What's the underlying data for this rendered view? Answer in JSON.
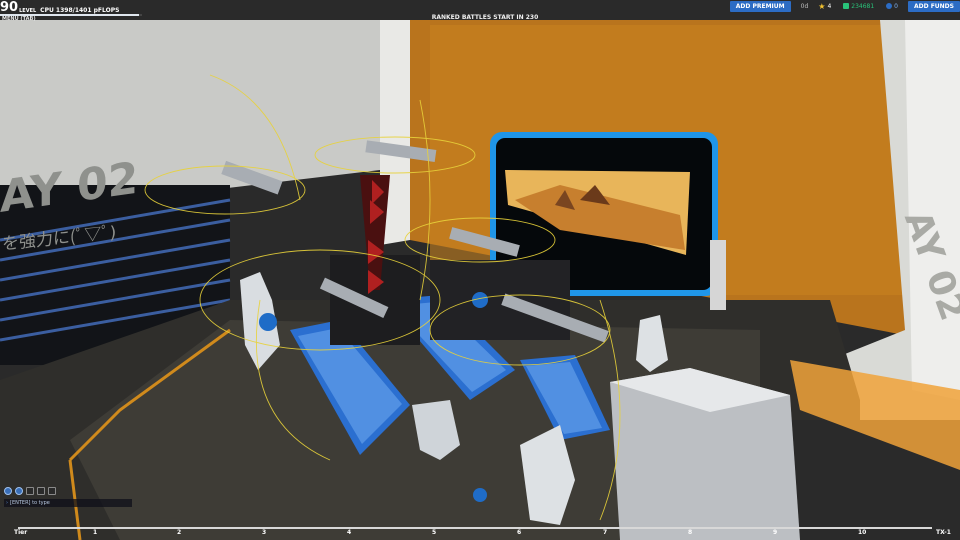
{
  "hud": {
    "level": "90",
    "level_word": "LEVEL",
    "cpu": "CPU 1398/1401 pFLOPS",
    "xp_progress": 0.98,
    "menu_tab": "MENU (TAB)",
    "ranked_banner": "RANKED BATTLES START IN 230"
  },
  "topbar": {
    "add_premium": "ADD PREMIUM",
    "premium_days": "0d",
    "stars": "4",
    "robits": "234681",
    "cosmetic": "0",
    "add_funds": "ADD FUNDS"
  },
  "colors": {
    "accent_blue": "#2c6cc4",
    "robits_green": "#29c37a",
    "wall_orange": "#c07a1a"
  },
  "chat": {
    "icons": [
      "chat-channel-icon",
      "party-icon",
      "all-chat-icon",
      "private-icon",
      "clan-icon"
    ],
    "prompt": "[ENTER] to type"
  },
  "tier_bar": {
    "label_start": "Tier",
    "labels": [
      "1",
      "2",
      "3",
      "4",
      "5",
      "6",
      "7",
      "8",
      "9",
      "10"
    ],
    "label_end": "TX-1"
  },
  "garage": {
    "wall_text_left": "AY 02",
    "wall_subtext": "を強力に(ﾟ▽ﾟ)",
    "wall_text_right": "AY 02"
  }
}
